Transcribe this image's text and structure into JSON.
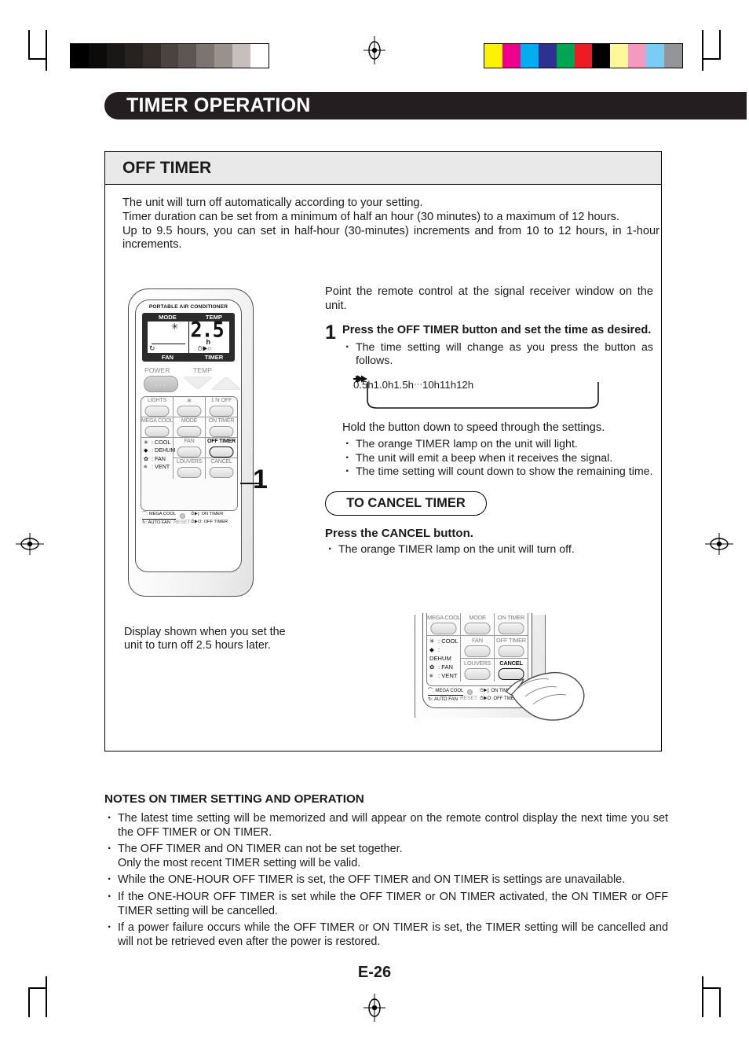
{
  "document": {
    "page_number": "E-26",
    "banner_title": "TIMER OPERATION",
    "section_title": "OFF TIMER"
  },
  "intro": {
    "line1": "The unit will turn off automatically according to your setting.",
    "line2": "Timer duration can be set from a minimum of half an hour (30 minutes) to a maximum of 12 hours.",
    "line3": "Up to 9.5 hours, you can set in half-hour (30-minutes) increments and from 10 to 12 hours, in 1-hour increments."
  },
  "right_column": {
    "lead": "Point the remote control at the signal receiver window on the unit.",
    "step_number": "1",
    "step_title": "Press the OFF TIMER button and set the time as desired.",
    "step_bullet": "The time setting will change as you press the button as follows.",
    "sequence": [
      "0.5h",
      "1.0h",
      "1.5h",
      "10h",
      "11h",
      "12h"
    ],
    "sequence_ellipsis": "···",
    "hold_text": "Hold the button down to speed through the settings.",
    "hold_bullets": [
      "The orange TIMER lamp on the unit will light.",
      "The unit will emit a beep when it receives the signal.",
      "The time setting will count down to show the remaining time."
    ],
    "cancel_pill": "TO CANCEL TIMER",
    "press_cancel": "Press the CANCEL button.",
    "cancel_bullet": "The orange TIMER lamp on the unit will turn off."
  },
  "left_caption": "Display shown when you set the unit to turn off 2.5 hours later.",
  "notes": {
    "title": "NOTES ON TIMER SETTING AND OPERATION",
    "items": [
      "The latest time setting will be memorized and will appear on the remote control display the next time you set the OFF TIMER or ON TIMER.",
      "The OFF TIMER and ON TIMER can not be set together.",
      "While the  ONE-HOUR OFF TIMER is set, the OFF TIMER and ON TIMER is settings are unavailable.",
      "If the ONE-HOUR OFF TIMER is set while the OFF TIMER or ON TIMER activated, the  ON TIMER or OFF TIMER setting will be cancelled.",
      "If a power failure occurs while the OFF TIMER or ON TIMER is set, the TIMER setting will be cancelled and will not be retrieved even after the power is restored."
    ],
    "item2_second_line": "Only the most recent TIMER setting will be valid."
  },
  "remote": {
    "brand_line": "PORTABLE AIR CONDITIONER",
    "lcd": {
      "header_left": "MODE",
      "header_right": "TEMP",
      "footer_left": "FAN",
      "footer_right": "TIMER",
      "mode_icon": "✳",
      "fan_icon": "↻",
      "value": "2.5",
      "unit": "h",
      "timer_icons": "⏱▶○"
    },
    "power_label": "POWER",
    "temp_label": "TEMP",
    "power_dots": "···",
    "buttons": [
      "LIGHTS",
      "❄",
      "1 hr OFF",
      "MEGA COOL",
      "MODE",
      "ON TIMER",
      "FAN",
      "OFF TIMER",
      "LOUVERS",
      "CANCEL"
    ],
    "highlight_button": "OFF TIMER",
    "mode_legend": [
      {
        "sym": "✳",
        "text": ": COOL"
      },
      {
        "sym": "◆",
        "text": ": DEHUM"
      },
      {
        "sym": "✿",
        "text": ": FAN"
      },
      {
        "sym": "≡",
        "text": ": VENT"
      }
    ],
    "bottom_legend_left": [
      {
        "sym": "⌒",
        "text": ": MEGA COOL"
      },
      {
        "sym": "↻",
        "text": ": AUTO FAN"
      }
    ],
    "bottom_legend_right": [
      {
        "sym": "⏱▶|",
        "text": ": ON TIMER"
      },
      {
        "sym": "⏱▶O",
        "text": ": OFF TIMER"
      }
    ],
    "reset_label": "RESET"
  },
  "detail_remote": {
    "buttons": [
      "MEGA COOL",
      "MODE",
      "ON TIMER",
      "FAN",
      "OFF TIMER",
      "LOUVERS",
      "CANCEL"
    ],
    "highlight_button": "CANCEL",
    "mode_legend": [
      {
        "sym": "✳",
        "text": ": COOL"
      },
      {
        "sym": "◆",
        "text": ": DEHUM"
      },
      {
        "sym": "✿",
        "text": ": FAN"
      },
      {
        "sym": "≡",
        "text": ": VENT"
      }
    ],
    "bottom_legend_left": [
      {
        "sym": "⌒",
        "text": ": MEGA COOL"
      },
      {
        "sym": "↻",
        "text": ": AUTO FAN"
      }
    ],
    "bottom_legend_right": [
      {
        "sym": "⏱▶|",
        "text": ": ON TIME"
      },
      {
        "sym": "⏱▶O",
        "text": ": OFF TME"
      }
    ],
    "reset_label": "RESET"
  },
  "print_marks": {
    "grayscale_steps": [
      "#000000",
      "#0b0b0b",
      "#1a1816",
      "#26221f",
      "#332e29",
      "#4a4340",
      "#5e5653",
      "#7c7471",
      "#9a918d",
      "#c6bfbb",
      "#ffffff"
    ],
    "color_steps": [
      "#fff200",
      "#ec008c",
      "#00aeef",
      "#2e3192",
      "#00a651",
      "#ed1c24",
      "#000000",
      "#fff79a",
      "#f49ac1",
      "#7accf4",
      "#939598"
    ]
  }
}
